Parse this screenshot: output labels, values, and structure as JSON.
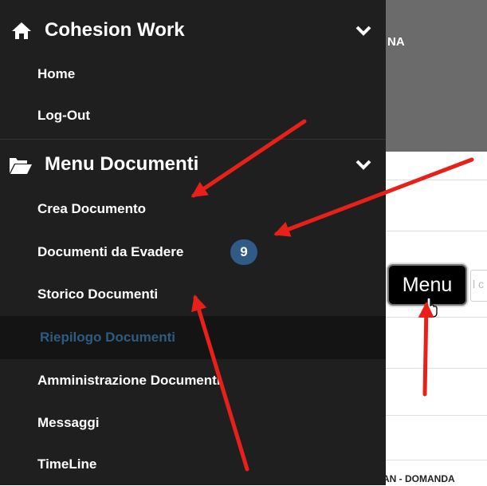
{
  "background": {
    "header_text": "NA",
    "search_placeholder": "l c",
    "bottom_text": "SAN - DOMANDA"
  },
  "tooltip": {
    "label": "Menu"
  },
  "sidebar": {
    "sections": [
      {
        "title": "Cohesion Work",
        "icon": "home-icon",
        "items": [
          {
            "label": "Home"
          },
          {
            "label": "Log-Out"
          }
        ]
      },
      {
        "title": "Menu Documenti",
        "icon": "folder-open-icon",
        "items": [
          {
            "label": "Crea Documento"
          },
          {
            "label": "Documenti da Evadere",
            "badge": "9"
          },
          {
            "label": "Storico Documenti"
          },
          {
            "label": "Riepilogo Documenti",
            "active": true
          },
          {
            "label": "Amministrazione Documenti"
          },
          {
            "label": "Messaggi"
          },
          {
            "label": "TimeLine"
          }
        ]
      }
    ]
  },
  "colors": {
    "sidebar_bg": "#1f1f1f",
    "active_item_bg": "#141414",
    "active_text": "#2e5b82",
    "badge_bg": "#2f5b86",
    "annotation_arrow": "#e8201a"
  }
}
